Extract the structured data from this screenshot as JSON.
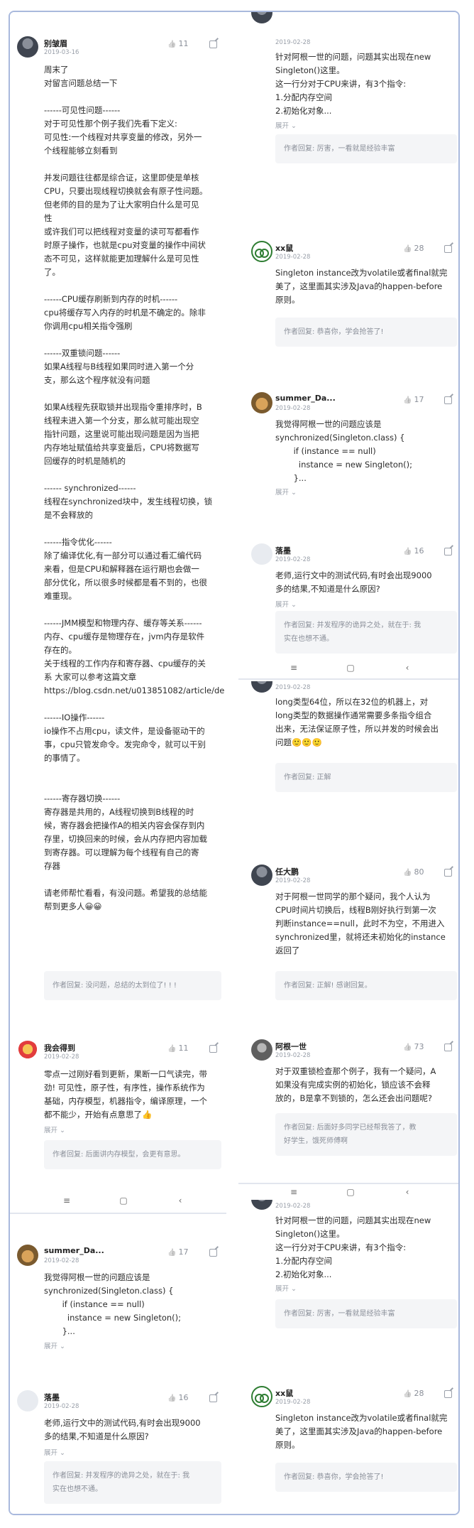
{
  "comments": {
    "c1": {
      "name": "别皱眉",
      "date": "2019-03-16",
      "likes": "11",
      "body": "周末了\n对留言问题总结一下\n\n------可见性问题------\n对于可见性那个例子我们先看下定义:\n可见性:一个线程对共享变量的修改，另外一\n个线程能够立刻看到\n\n并发问题往往都是综合证，这里即使是单核\nCPU，只要出现线程切换就会有原子性问题。\n但老师的目的是为了让大家明白什么是可见\n性\n或许我们可以把线程对变量的读可写都看作\n时原子操作，也就是cpu对变量的操作中间状\n态不可见，这样就能更加理解什么是可见性\n了。\n\n------CPU缓存刷新到内存的时机------\ncpu将缓存写入内存的时机是不确定的。除非\n你调用cpu相关指令强刷\n\n------双重锁问题------\n如果A线程与B线程如果同时进入第一个分\n支，那么这个程序就没有问题\n\n如果A线程先获取锁并出现指令重排序时，B\n线程未进入第一个分支，那么就可能出现空\n指针问题，这里说可能出现问题是因为当把\n内存地址赋值给共享变量后，CPU将数据写\n回缓存的时机是随机的\n\n------ synchronized------\n线程在synchronized块中，发生线程切换，锁\n是不会释放的\n\n------指令优化------\n除了编译优化,有一部分可以通过看汇编代码\n来看，但是CPU和解释器在运行期也会做一\n部分优化，所以很多时候都是看不到的，也很\n难重现。\n\n------JMM模型和物理内存、缓存等关系------\n内存、cpu缓存是物理存在，jvm内存是软件\n存在的。\n关于线程的工作内存和寄存器、cpu缓存的关\n系 大家可以参考这篇文章\nhttps://blog.csdn.net/u013851082/article/de\n\n------IO操作------\nio操作不占用cpu，读文件，是设备驱动干的\n事，cpu只管发命令。发完命令，就可以干别\n的事情了。\n\n\n------寄存器切换------\n寄存器是共用的，A线程切换到B线程的时\n候，寄存器会把操作A的相关内容会保存到内\n存里，切换回来的时候，会从内存把内容加载\n到寄存器。可以理解为每个线程有自己的寄\n存器\n\n请老师帮忙看看，有没问题。希望我的总结能\n帮到更多人😀😀",
      "reply": "作者回复: 没问题，总结的太到位了! ! !"
    },
    "c2": {
      "name": "我会得到",
      "date": "2019-02-28",
      "likes": "11",
      "body": "零点一过刚好看到更新，果断一口气读完，带\n劲! 可见性，原子性，有序性，操作系统作为\n基础，内存模型，机器指令，编译原理，一个\n都不能少，开始有点意思了👍",
      "expand": "展开",
      "reply": "作者回复: 后面讲内存模型，会更有意思。"
    },
    "c3": {
      "name": "summer_Da...",
      "date": "2019-02-28",
      "likes": "17",
      "body": "我觉得阿根一世的问题应该是\nsynchronized(Singleton.class) {\n       if (instance == null)\n         instance = new Singleton();\n       }...",
      "expand": "展开"
    },
    "c4": {
      "name": "落墨",
      "date": "2019-02-28",
      "likes": "16",
      "body": "老师,运行文中的测试代码,有时会出现9000\n多的结果,不知道是什么原因?",
      "expand": "展开",
      "reply": "作者回复: 并发程序的诡异之处，就在于: 我\n实在也想不通。"
    },
    "c5": {
      "date": "2019-02-28",
      "body": "针对阿根一世的问题，问题其实出现在new\nSingleton()这里。\n这一行分对于CPU来讲，有3个指令:\n1.分配内存空间\n2.初始化对象...",
      "expand": "展开",
      "reply": "作者回复: 厉害，一看就是经验丰富"
    },
    "c6": {
      "name": "xx鼠",
      "date": "2019-02-28",
      "likes": "28",
      "body": "Singleton instance改为volatile或者final就完\n美了，这里面其实涉及Java的happen-before\n原则。",
      "reply": "作者回复: 恭喜你，学会抢答了!"
    },
    "c7": {
      "date": "2019-02-28",
      "body": "long类型64位，所以在32位的机器上，对\nlong类型的数据操作通常需要多条指令组合\n出来，无法保证原子性，所以并发的时候会出\n问题🙂🙂🙂",
      "reply": "作者回复: 正解"
    },
    "c8": {
      "name": "任大鹏",
      "date": "2019-02-28",
      "likes": "80",
      "body": "对于阿根一世同学的那个疑问，我个人认为\nCPU时间片切换后，线程B刚好执行到第一次\n判断instance==null，此时不为空，不用进入\nsynchronized里，就将还未初始化的instance\n返回了",
      "reply": "作者回复: 正解! 感谢回复。"
    },
    "c9": {
      "name": "阿根一世",
      "date": "2019-02-28",
      "likes": "73",
      "body": "对于双重锁检查那个例子，我有一个疑问，A\n如果没有完成实例的初始化，锁应该不会释\n放的，B是拿不到锁的，怎么还会出问题呢?",
      "reply": "作者回复: 后面好多同学已经帮我答了，教\n好学生，饿死师傅啊"
    }
  },
  "navbar": {
    "menu": "≡",
    "home": "▢",
    "back": "‹"
  }
}
